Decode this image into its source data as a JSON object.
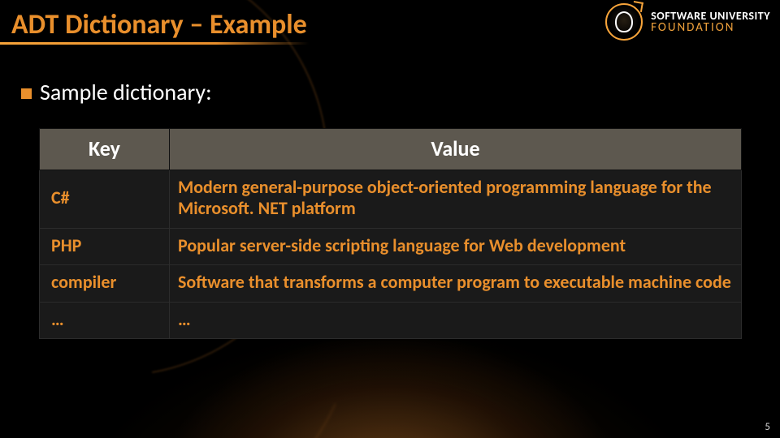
{
  "title": "ADT Dictionary – Example",
  "logo": {
    "line1": "SOFTWARE UNIVERSITY",
    "line2": "FOUNDATION"
  },
  "subtitle": "Sample dictionary:",
  "table": {
    "headers": {
      "key": "Key",
      "value": "Value"
    },
    "rows": [
      {
        "key": "C#",
        "value": "Modern general-purpose object-oriented programming language for the Microsoft. NET platform"
      },
      {
        "key": "PHP",
        "value": "Popular server-side scripting language for Web development"
      },
      {
        "key": "compiler",
        "value": "Software that transforms a computer program to executable machine code"
      },
      {
        "key": "…",
        "value": "…"
      }
    ]
  },
  "page_number": "5"
}
